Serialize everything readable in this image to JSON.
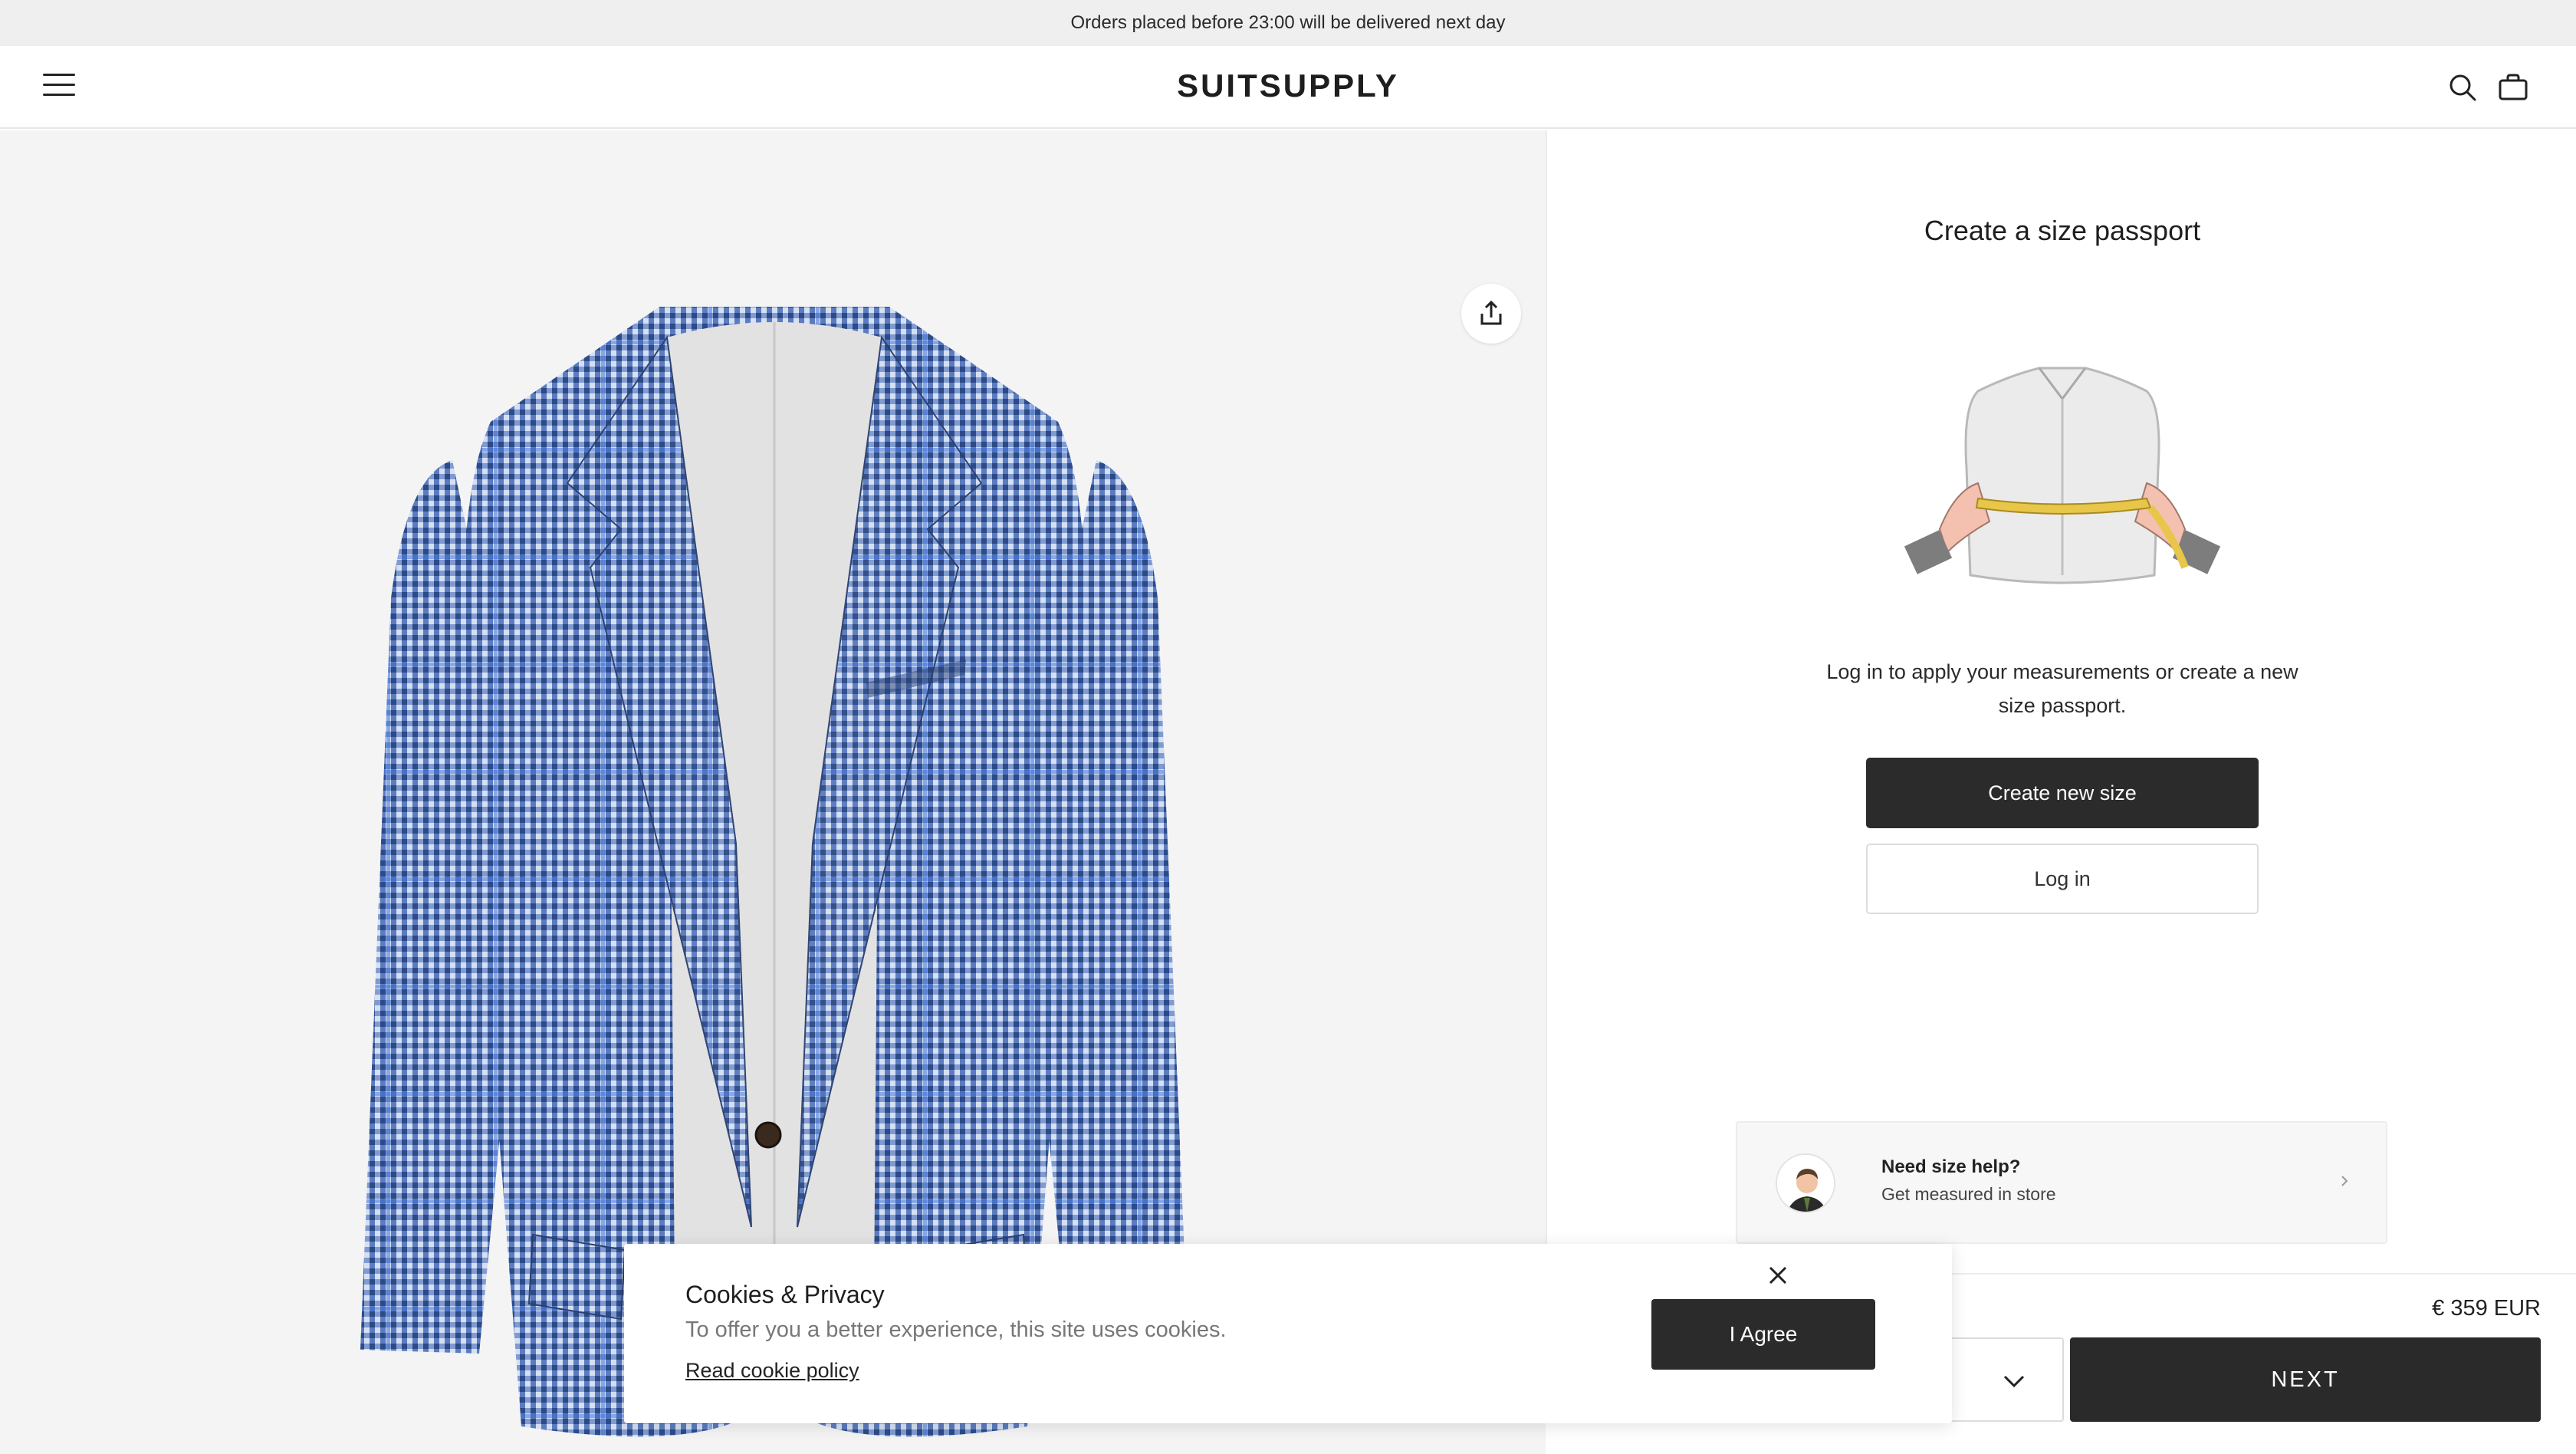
{
  "promo": {
    "text": "Orders placed before 23:00 will be delivered next day"
  },
  "header": {
    "logo": "SUITSUPPLY",
    "icons": [
      "menu-icon",
      "search-icon",
      "bag-icon"
    ]
  },
  "product_view": {
    "share_icon": "share-icon",
    "image_alt": "Blue houndstooth blazer"
  },
  "size_passport": {
    "title": "Create a size passport",
    "description": "Log in to apply your measurements or create a new size passport.",
    "create_button": "Create new size",
    "login_button": "Log in"
  },
  "size_help": {
    "title": "Need size help?",
    "subtitle": "Get measured in store"
  },
  "purchase": {
    "price": "€ 359 EUR",
    "size_value": "",
    "next_button": "NEXT"
  },
  "cookie_banner": {
    "title": "Cookies & Privacy",
    "text": "To offer you a better experience, this site uses cookies.",
    "link": "Read cookie policy",
    "agree_button": "I Agree"
  },
  "colors": {
    "dark_button": "#2b2b2b",
    "jacket_blue": "#4f6fae",
    "promo_bg": "#efefef",
    "pane_bg": "#f4f4f4"
  }
}
